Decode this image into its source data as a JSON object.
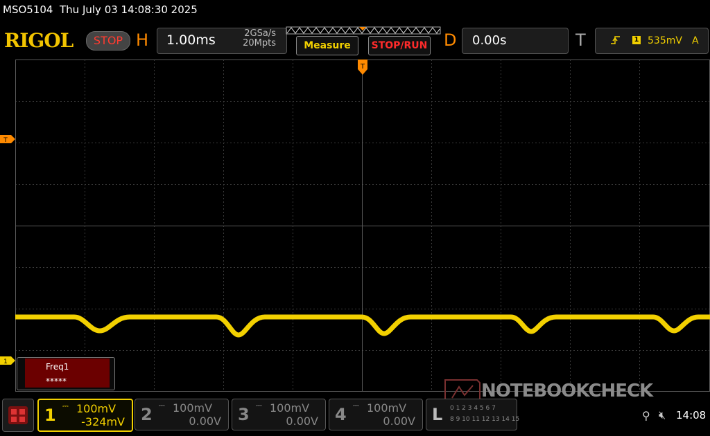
{
  "header": {
    "model": "MSO5104",
    "datetime": "Thu July 03 14:08:30 2025",
    "logo": "RIGOL",
    "status": "STOP"
  },
  "horizontal": {
    "letter": "H",
    "timebase": "1.00ms",
    "sample_rate": "2GSa/s",
    "memory_depth": "20Mpts"
  },
  "buttons": {
    "measure": "Measure",
    "stop_run": "STOP/RUN"
  },
  "delay": {
    "letter": "D",
    "value": "0.00s"
  },
  "trigger": {
    "letter": "T",
    "source": "1",
    "level": "535mV",
    "mode": "A",
    "edge_icon": "rising-edge-icon"
  },
  "markers": {
    "trigger_level": "T",
    "ch1_ground": "1",
    "trigger_position": "T"
  },
  "measurement": {
    "label": "Freq1",
    "value": "*****"
  },
  "channels": [
    {
      "num": "1",
      "scale": "100mV",
      "offset": "-324mV",
      "color": "#f2d000"
    },
    {
      "num": "2",
      "scale": "100mV",
      "offset": "0.00V",
      "color": "#888888"
    },
    {
      "num": "3",
      "scale": "100mV",
      "offset": "0.00V",
      "color": "#888888"
    },
    {
      "num": "4",
      "scale": "100mV",
      "offset": "0.00V",
      "color": "#888888"
    }
  ],
  "logic": {
    "letter": "L",
    "row1": "0 1 2 3 4 5 6 7",
    "row2": "8 9 10 11 12 13 14 15"
  },
  "status_bar": {
    "time": "14:08"
  },
  "watermark": "NOTEBOOKCHECK",
  "colors": {
    "ch1": "#f2d000",
    "accent": "#ff8a00",
    "stop": "#ff3b30"
  }
}
